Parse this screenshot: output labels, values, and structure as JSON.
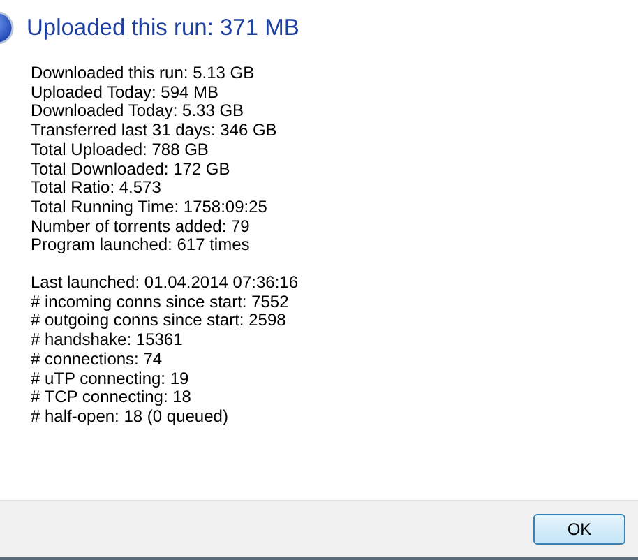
{
  "heading": "Uploaded this run: 371 MB",
  "groups": [
    [
      "Downloaded this run: 5.13 GB",
      "Uploaded Today: 594 MB",
      "Downloaded Today: 5.33 GB",
      "Transferred last 31 days: 346 GB",
      "Total Uploaded: 788 GB",
      "Total Downloaded: 172 GB",
      "Total Ratio: 4.573",
      "Total Running Time: 1758:09:25",
      "Number of torrents added: 79",
      "Program launched: 617 times"
    ],
    [
      "Last launched: 01.04.2014 07:36:16",
      "# incoming conns since start: 7552",
      "# outgoing conns since start: 2598",
      "# handshake: 15361",
      "# connections: 74",
      "# uTP connecting: 19",
      "# TCP connecting: 18",
      "# half-open: 18 (0 queued)"
    ]
  ],
  "buttons": [
    "OK"
  ]
}
